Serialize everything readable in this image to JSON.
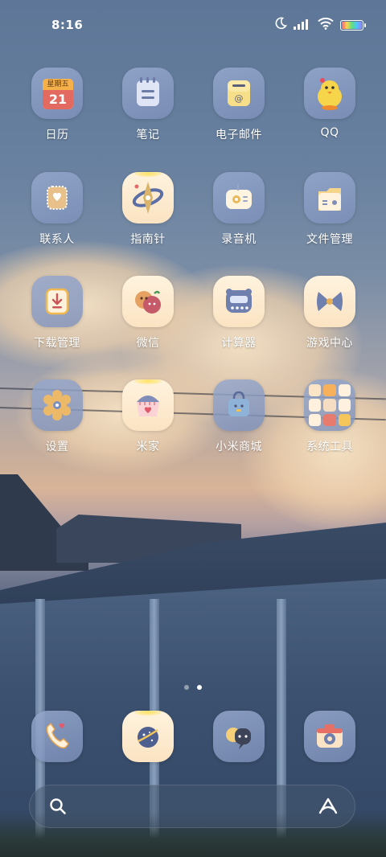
{
  "status_bar": {
    "time": "8:16",
    "icons": [
      "moon-icon",
      "signal-icon",
      "wifi-icon",
      "battery-icon"
    ]
  },
  "apps": [
    {
      "label": "日历",
      "icon": "calendar-icon",
      "calendar_weekday": "星期五",
      "calendar_day": "21"
    },
    {
      "label": "笔记",
      "icon": "notes-icon"
    },
    {
      "label": "电子邮件",
      "icon": "email-icon"
    },
    {
      "label": "QQ",
      "icon": "qq-penguin-icon"
    },
    {
      "label": "联系人",
      "icon": "contacts-icon"
    },
    {
      "label": "指南针",
      "icon": "compass-icon"
    },
    {
      "label": "录音机",
      "icon": "recorder-icon"
    },
    {
      "label": "文件管理",
      "icon": "file-manager-icon"
    },
    {
      "label": "下载管理",
      "icon": "download-icon"
    },
    {
      "label": "微信",
      "icon": "wechat-icon"
    },
    {
      "label": "计算器",
      "icon": "calculator-icon"
    },
    {
      "label": "游戏中心",
      "icon": "game-center-icon"
    },
    {
      "label": "设置",
      "icon": "settings-gear-icon"
    },
    {
      "label": "米家",
      "icon": "mijia-home-icon"
    },
    {
      "label": "小米商城",
      "icon": "mi-store-bag-icon"
    },
    {
      "label": "系统工具",
      "icon": "folder-icon"
    }
  ],
  "page_indicator": {
    "pages": 2,
    "current": 2
  },
  "dock": [
    {
      "icon": "phone-icon"
    },
    {
      "icon": "browser-planet-icon"
    },
    {
      "icon": "messages-icon"
    },
    {
      "icon": "camera-icon"
    }
  ],
  "search_bar": {
    "left_icon": "search-icon",
    "right_icon": "assistant-icon"
  },
  "colors": {
    "icon_glass": "#8d9fc7",
    "icon_cream": "#fdeacd",
    "accent_yellow": "#f5c542",
    "label_text": "#ffffff"
  }
}
